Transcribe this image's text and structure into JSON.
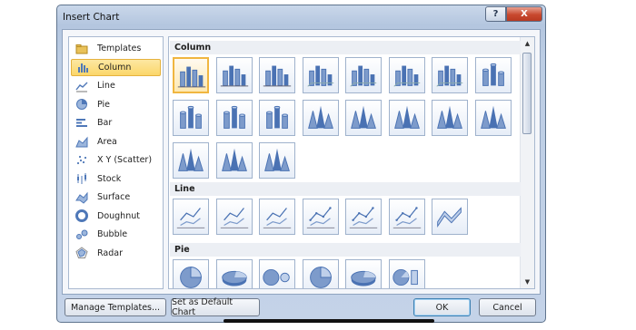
{
  "window": {
    "title": "Insert Chart",
    "help": "?",
    "close": "X"
  },
  "chart_types": [
    {
      "label": "Templates",
      "icon": "folder-icon"
    },
    {
      "label": "Column",
      "icon": "column-chart-icon",
      "selected": true
    },
    {
      "label": "Line",
      "icon": "line-chart-icon"
    },
    {
      "label": "Pie",
      "icon": "pie-chart-icon"
    },
    {
      "label": "Bar",
      "icon": "bar-chart-icon"
    },
    {
      "label": "Area",
      "icon": "area-chart-icon"
    },
    {
      "label": "X Y (Scatter)",
      "icon": "scatter-chart-icon"
    },
    {
      "label": "Stock",
      "icon": "stock-chart-icon"
    },
    {
      "label": "Surface",
      "icon": "surface-chart-icon"
    },
    {
      "label": "Doughnut",
      "icon": "doughnut-chart-icon"
    },
    {
      "label": "Bubble",
      "icon": "bubble-chart-icon"
    },
    {
      "label": "Radar",
      "icon": "radar-chart-icon"
    }
  ],
  "gallery": {
    "sections": [
      {
        "title": "Column",
        "thumbnails": [
          "clustered-column",
          "stacked-column",
          "100-stacked-column",
          "3d-clustered-column",
          "3d-stacked-column",
          "3d-100-stacked-column",
          "3d-column",
          "clustered-cylinder",
          "stacked-cylinder",
          "100-stacked-cylinder",
          "3d-cylinder",
          "clustered-cone",
          "stacked-cone",
          "100-stacked-cone",
          "3d-cone",
          "clustered-pyramid",
          "stacked-pyramid",
          "100-stacked-pyramid",
          "3d-pyramid"
        ]
      },
      {
        "title": "Line",
        "thumbnails": [
          "line",
          "stacked-line",
          "100-stacked-line",
          "line-markers",
          "stacked-line-markers",
          "100-stacked-line-markers",
          "3d-line"
        ]
      },
      {
        "title": "Pie",
        "thumbnails": [
          "pie",
          "3d-pie",
          "pie-of-pie",
          "exploded-pie",
          "3d-exploded-pie",
          "bar-of-pie"
        ]
      }
    ],
    "selected": "clustered-column"
  },
  "buttons": {
    "manage_templates": "Manage Templates...",
    "set_default": "Set as Default Chart",
    "ok": "OK",
    "cancel": "Cancel"
  },
  "colors": {
    "accent_selected": "#fbd66a",
    "thumb_blue": "#5b82c0"
  }
}
